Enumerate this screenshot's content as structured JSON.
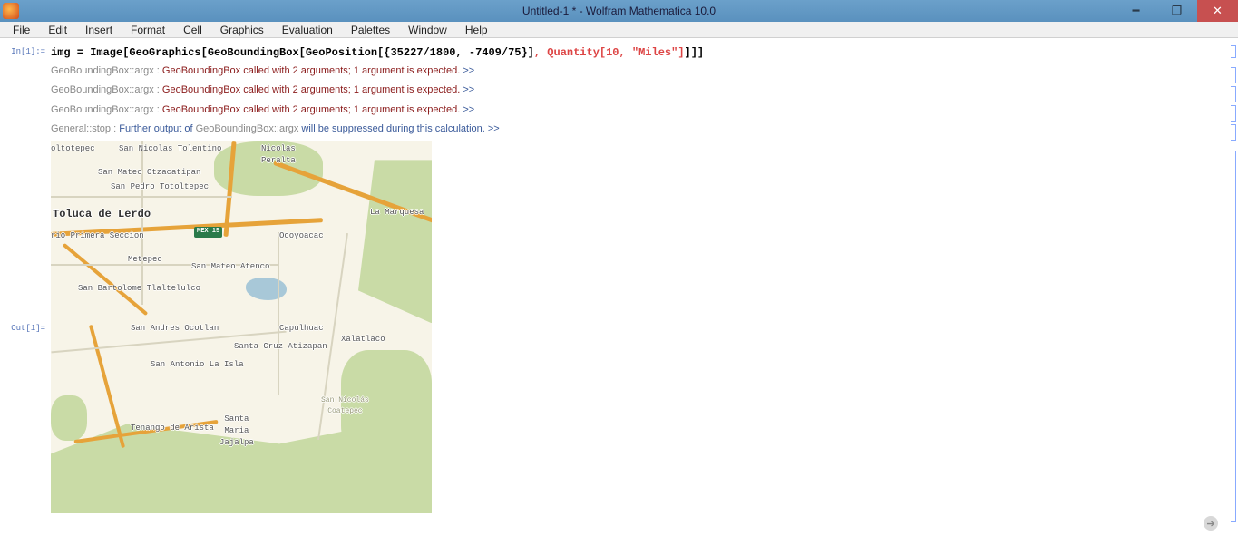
{
  "window": {
    "title": "Untitled-1 * - Wolfram Mathematica 10.0"
  },
  "menu": {
    "items": [
      "File",
      "Edit",
      "Insert",
      "Format",
      "Cell",
      "Graphics",
      "Evaluation",
      "Palettes",
      "Window",
      "Help"
    ]
  },
  "cells": {
    "in_label": "In[1]:=",
    "out_label": "Out[1]=",
    "code_plain_1": "img = Image[GeoGraphics[GeoBoundingBox[GeoPosition[{35227/1800, -7409/75}]",
    "code_quantity": ", Quantity[10, \"Miles\"]",
    "code_plain_2": "]]]",
    "msg_tag": "GeoBoundingBox::argx",
    "msg_colon": " : ",
    "msg_text": "GeoBoundingBox called with 2 arguments; 1 argument is expected.",
    "msg_more": " >>",
    "gen_tag": "General::stop",
    "gen_t1": "Further output of ",
    "gen_mid": "GeoBoundingBox::argx",
    "gen_t2": " will be suppressed during this calculation.",
    "gen_more": " >>"
  },
  "map_labels": {
    "toltepec": "oltotepec",
    "san_nicolas_tolentino": "San Nicolas Tolentino",
    "nicolas_peralta": "Nicolas\nPeralta",
    "san_mateo_otzacatipan": "San Mateo Otzacatipan",
    "san_pedro_totoltepec": "San Pedro Totoltepec",
    "toluca": "Toluca de Lerdo",
    "la_marquesa": "La Marquesa",
    "rio_primera": "rio Primera Seccion",
    "metepec": "Metepec",
    "san_mateo_atenco": "San Mateo Atenco",
    "ocoyoacac": "Ocoyoacac",
    "san_bartolome": "San Bartolome Tlaltelulco",
    "san_andres": "San Andres Ocotlan",
    "capulhuac": "Capulhuac",
    "xalatlaco": "Xalatlaco",
    "santa_cruz": "Santa Cruz Atizapan",
    "san_antonio": "San Antonio La Isla",
    "san_nicolas_coatepec": "San Nicolás\nCoatepec",
    "tenango": "Tenango de Arista",
    "santa_maria_jajalpa": "Santa\nMaria\nJajalpa",
    "mex15": "MEX 15"
  }
}
